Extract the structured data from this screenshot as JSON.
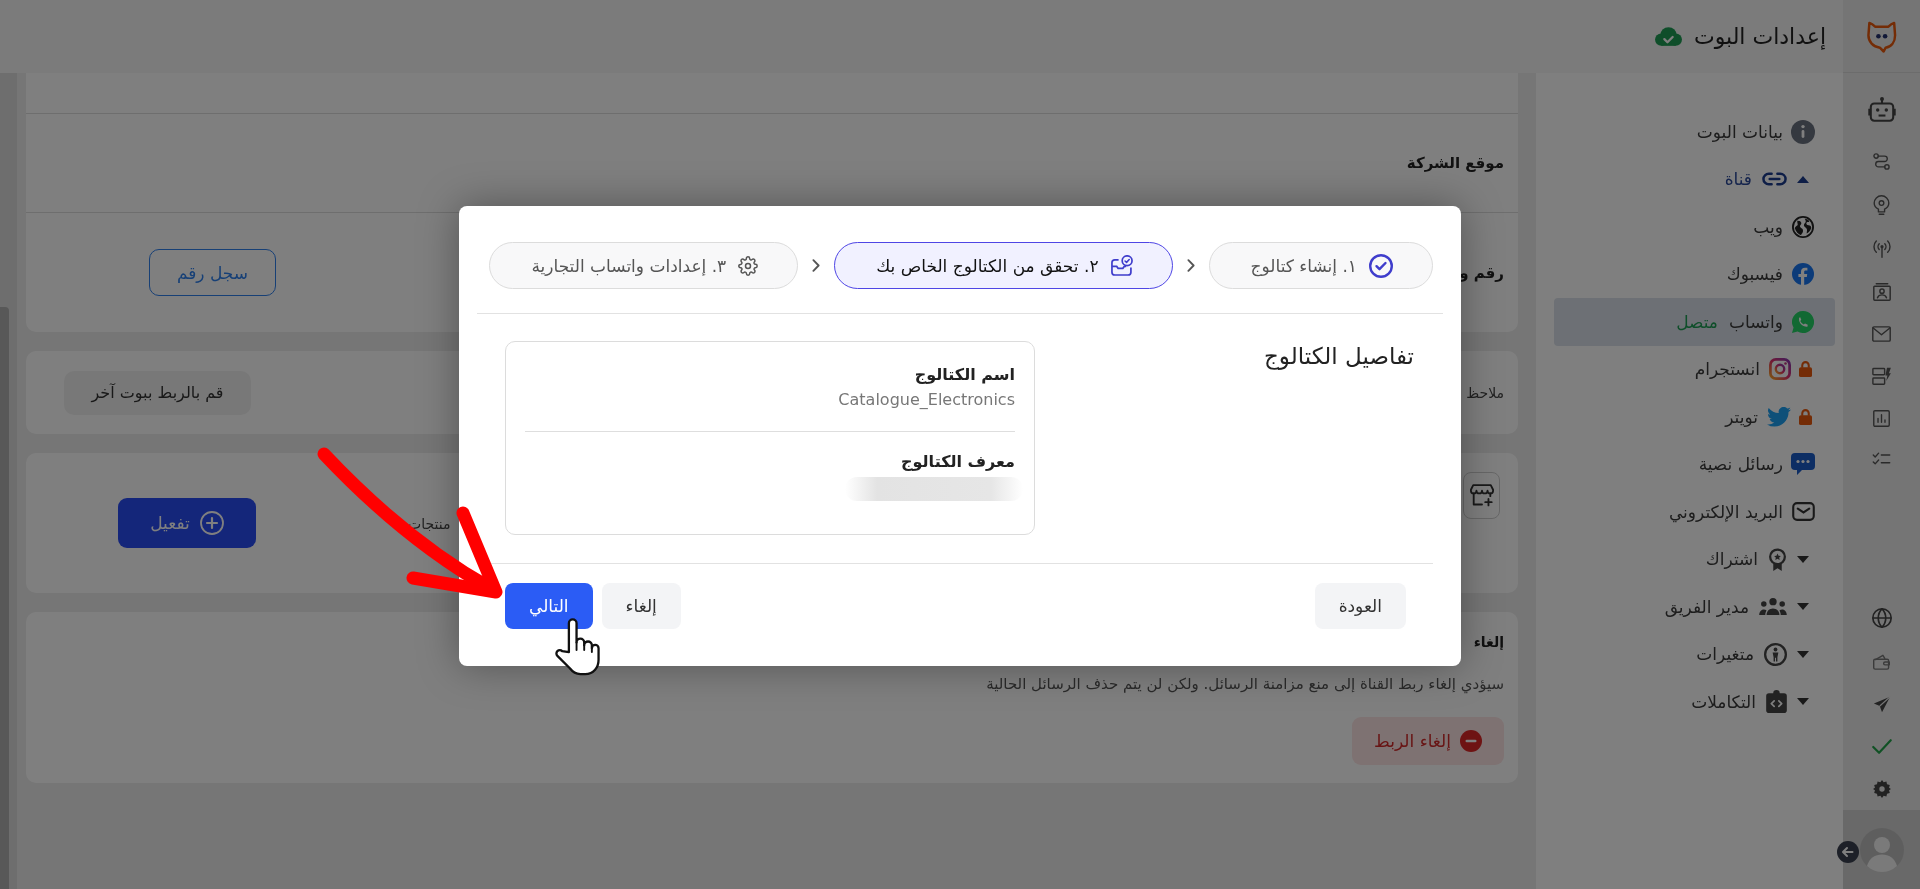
{
  "header": {
    "title": "إعدادات البوت"
  },
  "sidebar": {
    "items": [
      {
        "label": "بيانات البوت",
        "selected": false
      },
      {
        "label": "قناة",
        "selected": false,
        "expanded": true,
        "children": [
          {
            "label": "ويب",
            "selected": false,
            "locked": false
          },
          {
            "label": "فيسبوك",
            "selected": false,
            "locked": false
          },
          {
            "label": "واتساب",
            "status": "متصل",
            "selected": true,
            "locked": false
          },
          {
            "label": "انستجرام",
            "selected": false,
            "locked": true
          },
          {
            "label": "تويتر",
            "selected": false,
            "locked": true
          },
          {
            "label": "رسائل نصية",
            "selected": false,
            "locked": false
          },
          {
            "label": "البريد الإلكتروني",
            "selected": false,
            "locked": false
          }
        ]
      },
      {
        "label": "اشتراك",
        "selected": false,
        "expanded": false
      },
      {
        "label": "مدير الفريق",
        "selected": false,
        "expanded": false
      },
      {
        "label": "متغيرات",
        "selected": false,
        "expanded": false
      },
      {
        "label": "التكاملات",
        "selected": false,
        "expanded": false
      }
    ]
  },
  "main": {
    "settings_card": {
      "rows": [
        {
          "label": "موقع الشركة"
        },
        {
          "label": "رقم و",
          "button": "سجل رقم"
        }
      ]
    },
    "note_card": {
      "text": "ملاحظ",
      "button": "قم بالربط ببوت آخر"
    },
    "catalog_card": {
      "text": "منتجات",
      "button": "تفعيل"
    },
    "unlink_card": {
      "title": "إلغاء",
      "text": "سيؤدي إلغاء ربط القناة إلى منع مزامنة الرسائل. ولكن لن يتم حذف الرسائل الحالية",
      "button": "إلغاء الربط"
    }
  },
  "modal": {
    "steps": [
      {
        "label": "١. إنشاء كتالوج",
        "completed": true,
        "selected": false
      },
      {
        "label": "٢. تحقق من الكتالوج الخاص بك",
        "completed": false,
        "selected": true
      },
      {
        "label": "٣. إعدادات واتساب التجارية",
        "completed": false,
        "selected": false
      }
    ],
    "title": "تفاصيل الكتالوج",
    "fields": [
      {
        "label": "اسم الكتالوج",
        "value": "Catalogue_Electronics",
        "redacted": false
      },
      {
        "label": "معرف الكتالوج",
        "redacted": true
      }
    ],
    "buttons": [
      {
        "label": "العودة",
        "kind": "secondary"
      },
      {
        "label": "إلغاء",
        "kind": "secondary"
      },
      {
        "label": "التالي",
        "kind": "primary"
      }
    ]
  }
}
